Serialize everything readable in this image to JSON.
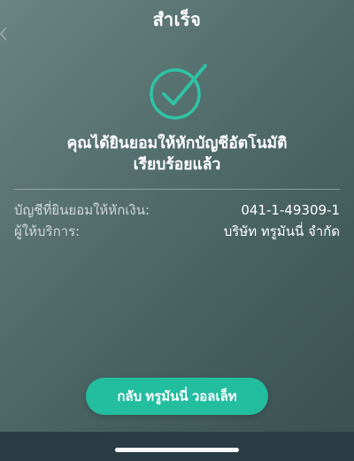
{
  "header": {
    "title": "สำเร็จ"
  },
  "status": {
    "icon": "checkmark-circle-icon",
    "accent_color": "#2ec4a6",
    "message_line1": "คุณได้ยินยอมให้หักบัญชีอัตโนมัติ",
    "message_line2": "เรียบร้อยแล้ว"
  },
  "details": {
    "rows": [
      {
        "label": "บัญชีที่ยินยอมให้หักเงิน:",
        "value": "041-1-49309-1"
      },
      {
        "label": "ผู้ให้บริการ:",
        "value": "บริษัท ทรูมันนี่ จำกัด"
      }
    ]
  },
  "actions": {
    "back_to_wallet_label": "กลับ ทรูมันนี่ วอลเล็ท",
    "button_color": "#23bda0"
  }
}
